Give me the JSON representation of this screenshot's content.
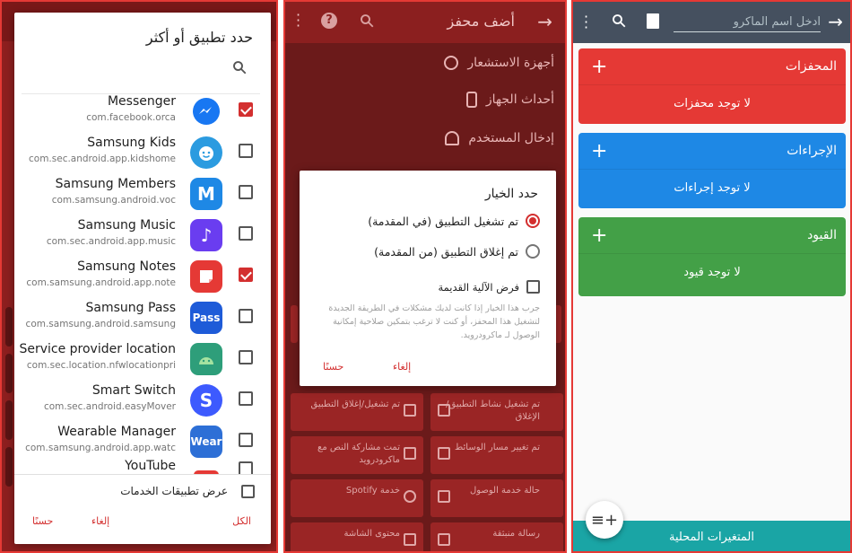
{
  "panel1": {
    "dialog_title": "حدد تطبيق أو أكثر",
    "apps": [
      {
        "name": "Messenger",
        "package": "com.facebook.orca",
        "icon": "messenger-icon",
        "color": "#1877f2",
        "checked": true
      },
      {
        "name": "Samsung Kids",
        "package": "com.sec.android.app.kidshome",
        "icon": "kids-icon",
        "color": "#2b9be0",
        "checked": false
      },
      {
        "name": "Samsung Members",
        "package": "com.samsung.android.voc",
        "icon": "members-icon",
        "color": "#1e88e5",
        "checked": false
      },
      {
        "name": "Samsung Music",
        "package": "com.sec.android.app.music",
        "icon": "music-icon",
        "color": "#6a3df0",
        "checked": false
      },
      {
        "name": "Samsung Notes",
        "package": "com.samsung.android.app.note",
        "icon": "notes-icon",
        "color": "#e53935",
        "checked": true
      },
      {
        "name": "Samsung Pass",
        "package": "com.samsung.android.samsung",
        "icon": "pass-icon",
        "color": "#1e5bd8",
        "icon_text": "Pass",
        "checked": false
      },
      {
        "name": "Service provider location",
        "package": "com.sec.location.nfwlocationpri",
        "icon": "android-icon",
        "color": "#2e9e7a",
        "checked": false
      },
      {
        "name": "Smart Switch",
        "package": "com.sec.android.easyMover",
        "icon": "smart-switch-icon",
        "color": "#3d5afe",
        "icon_text": "S",
        "checked": false
      },
      {
        "name": "Wearable Manager",
        "package": "com.samsung.android.app.watc",
        "icon": "wear-icon",
        "color": "#2d6fd6",
        "icon_text": "Wear",
        "checked": false
      },
      {
        "name": "YouTube",
        "package": "",
        "icon": "youtube-icon",
        "color": "#e53935",
        "checked": false
      }
    ],
    "show_services_label": "عرض تطبيقات الخدمات",
    "all_label": "الكل",
    "cancel_label": "إلغاء",
    "ok_label": "حسنًا"
  },
  "panel2": {
    "title": "أضف محفز",
    "rows": [
      {
        "label": "أجهزة الاستشعار"
      },
      {
        "label": "أحداث الجهاز"
      },
      {
        "label": "إدخال المستخدم"
      }
    ],
    "tiles": [
      {
        "label": "تم تشغيل نشاط التطبيق/الإغلاق"
      },
      {
        "label": "تم تشغيل/إغلاق التطبيق"
      },
      {
        "label": "تم تغيير مسار الوسائط"
      },
      {
        "label": "تمت مشاركة النص مع ماكرودرويد"
      },
      {
        "label": "حالة خدمة الوصول"
      },
      {
        "label": "خدمة Spotify"
      },
      {
        "label": "رسالة منبثقة"
      },
      {
        "label": "محتوى الشاشة"
      }
    ],
    "dialog": {
      "title": "حدد الخيار",
      "option_launched": "تم تشغيل التطبيق (في المقدمة)",
      "option_closed": "تم إغلاق التطبيق (من المقدمة)",
      "legacy_label": "فرض الآلية القديمة",
      "description": "جرب هذا الخيار إذا كانت لديك مشكلات في الطريقة الجديدة لتشغيل هذا المحفز، أو كنت لا ترغب بتمكين صلاحية إمكانية الوصول لـ ماكرودرويد.",
      "cancel_label": "إلغاء",
      "ok_label": "حسنًا"
    }
  },
  "panel3": {
    "name_placeholder": "ادخل اسم الماكرو",
    "triggers": {
      "title": "المحفزات",
      "empty": "لا توجد محفزات",
      "color": "#e53935"
    },
    "actions": {
      "title": "الإجراءات",
      "empty": "لا توجد إجراءات",
      "color": "#1e88e5"
    },
    "constraints": {
      "title": "القيود",
      "empty": "لا توجد قيود",
      "color": "#43a047"
    },
    "local_vars_label": "المتغيرات المحلية"
  }
}
